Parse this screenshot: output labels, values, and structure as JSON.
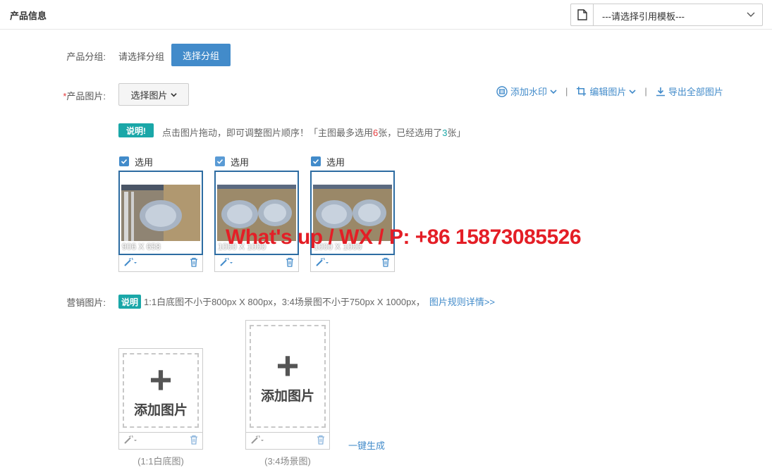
{
  "header": {
    "title": "产品信息",
    "template_placeholder": "---请选择引用模板---"
  },
  "group_row": {
    "label": "产品分组:",
    "placeholder": "请选择分组",
    "button_label": "选择分组"
  },
  "images_row": {
    "required_mark": "*",
    "label": "产品图片:",
    "select_button": "选择图片",
    "toolbar": {
      "watermark": "添加水印",
      "edit": "编辑图片",
      "export": "导出全部图片"
    },
    "badge": "说明!",
    "note_prefix": "点击图片拖动，即可调整图片顺序！「主图最多选用",
    "note_max": "6",
    "note_middle": "张，已经选用了",
    "note_used": "3",
    "note_suffix": "张」",
    "cards": [
      {
        "check_label": "选用",
        "dimensions": "906 X 658",
        "checked": true
      },
      {
        "check_label": "选用",
        "dimensions": "1000 X 1000",
        "checked": true
      },
      {
        "check_label": "选用",
        "dimensions": "1000 X 1000",
        "checked": true
      }
    ]
  },
  "marketing_row": {
    "label": "营销图片:",
    "badge": "说明",
    "note": "1:1白底图不小于800px X 800px，3:4场景图不小于750px X 1000px，",
    "rules_link": "图片规则详情>>",
    "slots": [
      {
        "add_text": "添加图片",
        "caption": "(1:1白底图)"
      },
      {
        "add_text": "添加图片",
        "caption": "(3:4场景图)"
      }
    ],
    "one_click": "一键生成"
  },
  "watermark_text": "What's up / WX / P: +86 15873085526",
  "colors": {
    "primary": "#428bca",
    "badge": "#1aa7a8",
    "required": "#e4393c",
    "watermark": "#e41e26"
  },
  "icons": [
    "file-icon",
    "chevron-down-icon",
    "watermark-icon",
    "crop-icon",
    "download-icon",
    "magic-wand-icon",
    "trash-icon",
    "plus-icon",
    "checkbox-icon"
  ]
}
